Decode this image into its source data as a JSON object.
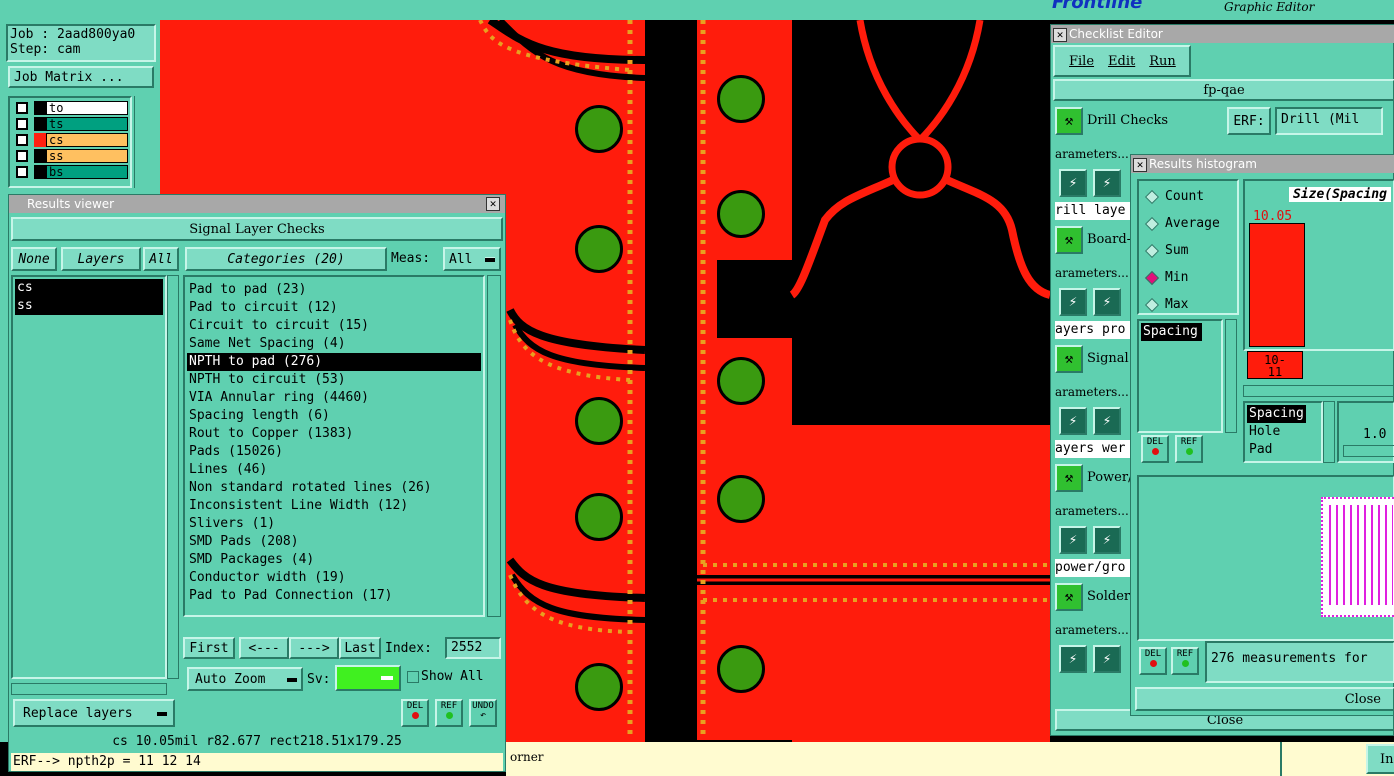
{
  "top_bar": {
    "app_brand": "Frontline",
    "subtitle": "Graphic Editor"
  },
  "job": {
    "job_line": "Job : 2aad800ya0",
    "step_line": "Step: cam",
    "job_matrix_label": "Job Matrix ..."
  },
  "layers_panel": [
    {
      "name": "to",
      "bg": "#ffffff",
      "swatch": "#000000"
    },
    {
      "name": "ts",
      "bg": "#00a080",
      "swatch": "#000000"
    },
    {
      "name": "cs",
      "bg": "#ffc060",
      "swatch": "#ff2010"
    },
    {
      "name": "ss",
      "bg": "#ffc060",
      "swatch": "#000000"
    },
    {
      "name": "bs",
      "bg": "#00a080",
      "swatch": "#000000"
    }
  ],
  "results_viewer": {
    "window_title": "Results viewer",
    "header": "Signal Layer Checks",
    "btn_none": "None",
    "btn_layers": "Layers",
    "btn_all": "All",
    "layers": [
      "cs",
      "ss"
    ],
    "categories_btn": "Categories (20)",
    "meas_label": "Meas:",
    "meas_value": "All",
    "categories": [
      "Pad to pad (23)",
      "Pad to circuit (12)",
      "Circuit to circuit (15)",
      "Same Net Spacing (4)",
      "NPTH to pad (276)",
      "NPTH to circuit (53)",
      "VIA Annular ring (4460)",
      "Spacing length (6)",
      "Rout to Copper (1383)",
      "Pads (15026)",
      "Lines (46)",
      "Non standard rotated lines (26)",
      "Inconsistent Line Width (12)",
      "Slivers (1)",
      "SMD Pads (208)",
      "SMD Packages (4)",
      "Conductor width (19)",
      "Pad to Pad Connection (17)"
    ],
    "selected_index": 4,
    "nav_first": "First",
    "nav_prev": "<---",
    "nav_next": "--->",
    "nav_last": "Last",
    "index_label": "Index:",
    "index_value": "2552",
    "auto_zoom": "Auto Zoom",
    "sv_label": "Sv:",
    "show_all": "Show All",
    "replace_layers": "Replace layers",
    "del_label": "DEL",
    "ref_label": "REF",
    "undo_label": "UNDO",
    "status_line": "cs 10.05mil  r82.677  rect218.51x179.25",
    "erf_line": "ERF--> npth2p = 11 12 14"
  },
  "bottom_status": {
    "corner_text": "orner",
    "right_btn": "In"
  },
  "checklist_editor": {
    "window_title": "Checklist Editor",
    "menu": [
      "File",
      "Edit",
      "Run"
    ],
    "checklist_name": "fp-qae",
    "erf_label": "ERF:",
    "erf_value": "Drill (Mil",
    "items": [
      {
        "label": "Drill Checks",
        "params": "arameters...",
        "sub": "rill laye"
      },
      {
        "label": "Board-",
        "params": "arameters...",
        "sub": "ayers pro"
      },
      {
        "label": "Signal",
        "params": "arameters...",
        "sub": "ayers wer"
      },
      {
        "label": "Power/",
        "params": "arameters...",
        "sub": "power/gro"
      },
      {
        "label": "Solder",
        "params": "arameters...",
        "sub": ""
      }
    ],
    "close_label": "Close"
  },
  "histogram": {
    "window_title": "Results histogram",
    "modes": [
      "Count",
      "Average",
      "Sum",
      "Min",
      "Max"
    ],
    "selected_mode": "Min",
    "list_label": "Spacing",
    "chart_title": "Size(Spacing",
    "bar_value": "10.05",
    "bar_range": "10-\n11",
    "types": [
      "Spacing",
      "Hole",
      "Pad"
    ],
    "scale_value": "1.0",
    "del_label": "DEL",
    "ref_label": "REF",
    "measurements_text": "276 measurements for",
    "close_label": "Close"
  },
  "colors": {
    "motif_bg": "#5fd0b0",
    "copper": "#ff1c0c",
    "pad_green": "#3a9a10",
    "dots": "#e8a020"
  }
}
